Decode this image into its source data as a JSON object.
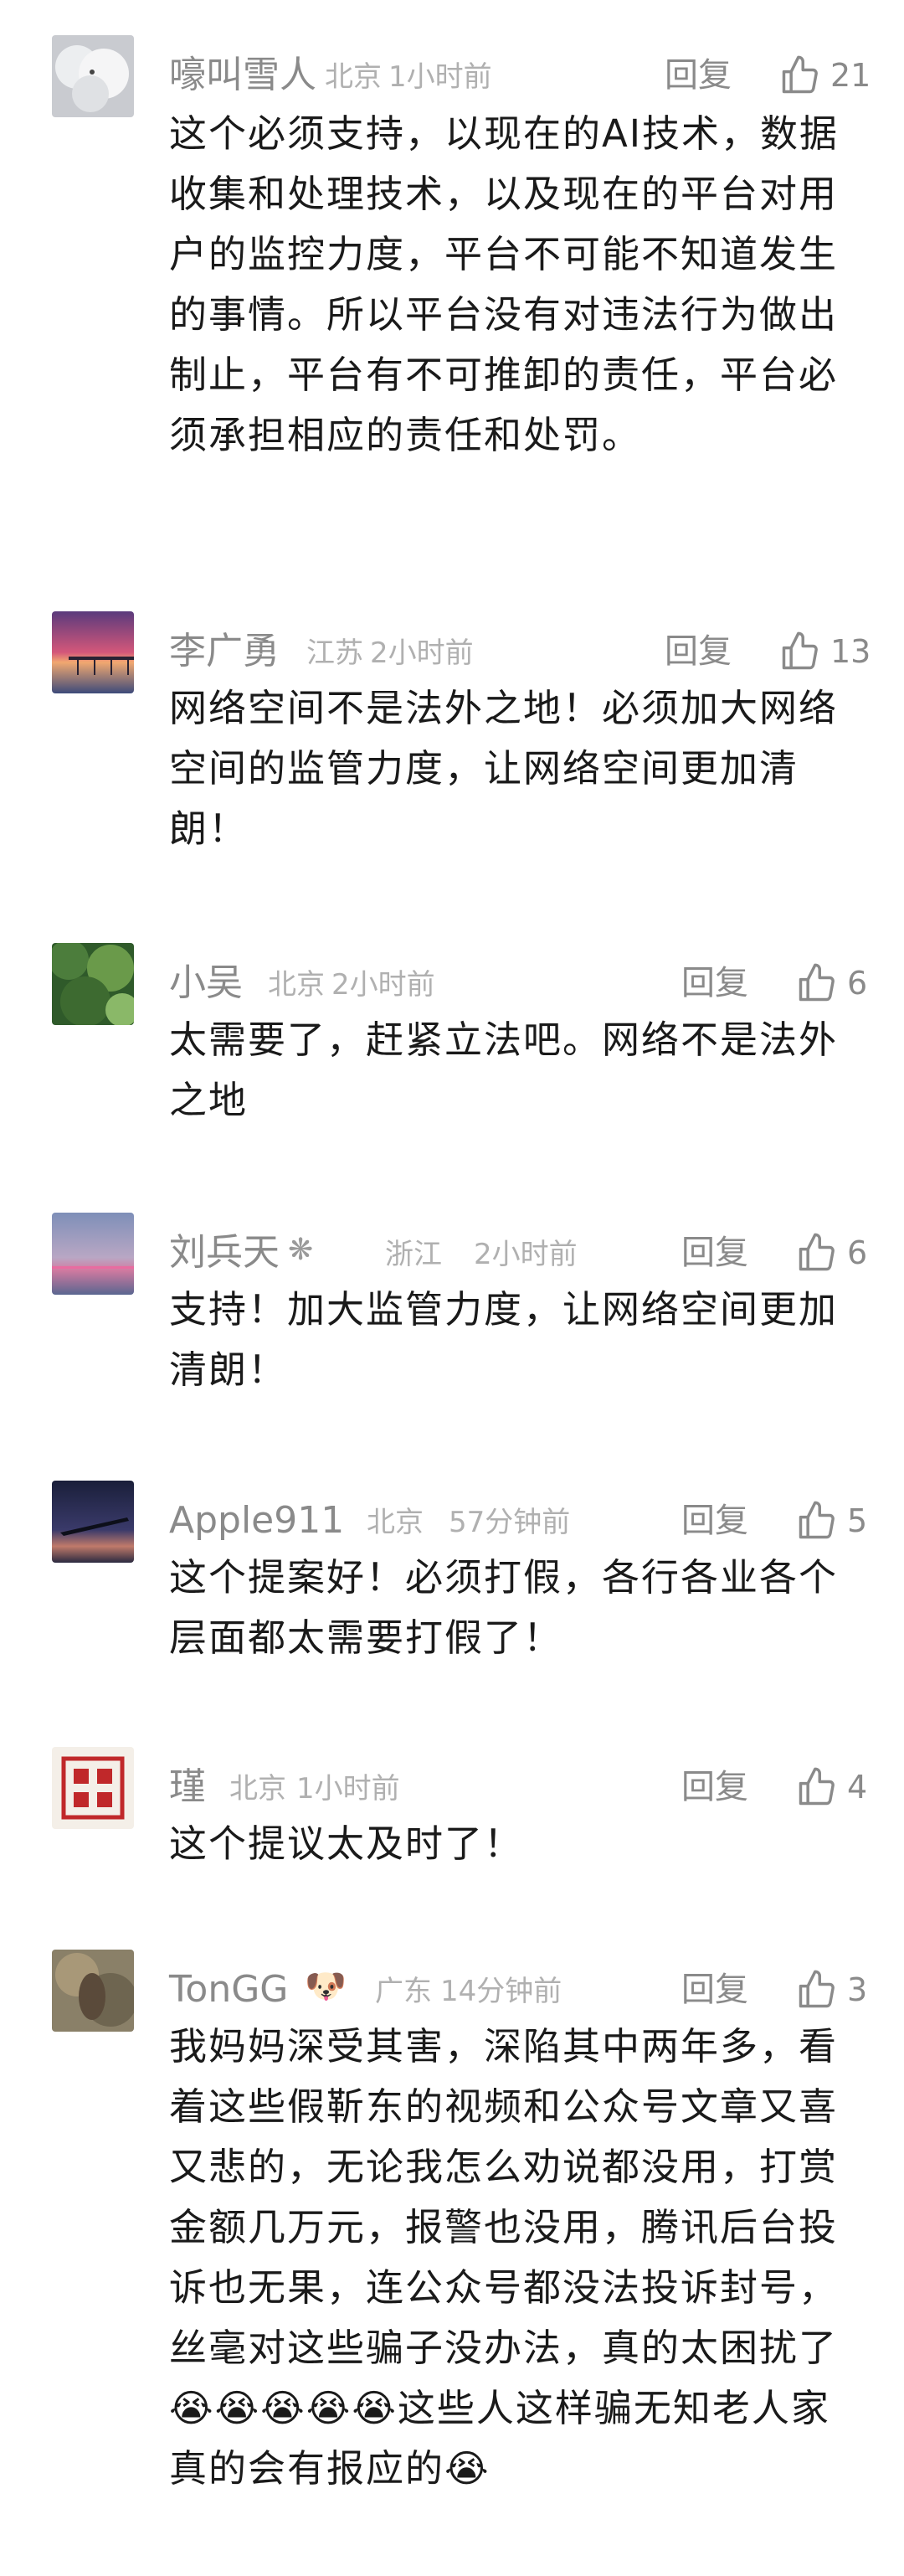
{
  "comments": [
    {
      "name": "嚎叫雪人",
      "location": "北京",
      "time": "1小时前",
      "reply": "回复",
      "likes": "21",
      "text": "这个必须支持，以现在的AI技术，数据收集和处理技术，以及现在的平台对用户的监控力度，平台不可能不知道发生的事情。所以平台没有对违法行为做出制止，平台有不可推卸的责任，平台必须承担相应的责任和处罚。"
    },
    {
      "name": "李广勇",
      "location": "江苏",
      "time": "2小时前",
      "reply": "回复",
      "likes": "13",
      "text": "网络空间不是法外之地！必须加大网络空间的监管力度，让网络空间更加清朗！"
    },
    {
      "name": "小吴",
      "location": "北京",
      "time": "2小时前",
      "reply": "回复",
      "likes": "6",
      "text": "太需要了，赶紧立法吧。网络不是法外之地"
    },
    {
      "name": "刘兵天",
      "location": "浙江",
      "time": "2小时前",
      "reply": "回复",
      "likes": "6",
      "text": "支持！加大监管力度，让网络空间更加清朗！"
    },
    {
      "name": "Apple911",
      "location": "北京",
      "time": "57分钟前",
      "reply": "回复",
      "likes": "5",
      "text": "这个提案好！必须打假，各行各业各个层面都太需要打假了！"
    },
    {
      "name": "瑾",
      "location": "北京",
      "time": "1小时前",
      "reply": "回复",
      "likes": "4",
      "text": "这个提议太及时了！"
    },
    {
      "name": "TonGG",
      "name_emoji": "🐶",
      "location": "广东",
      "time": "14分钟前",
      "reply": "回复",
      "likes": "3",
      "text": "我妈妈深受其害，深陷其中两年多，看着这些假靳东的视频和公众号文章又喜又悲的，无论我怎么劝说都没用，打赏金额几万元，报警也没用，腾讯后台投诉也无果，连公众号都没法投诉封号，丝毫对这些骗子没办法，真的太困扰了😭😭😭😭😭这些人这样骗无知老人家真的会有报应的😭"
    }
  ]
}
